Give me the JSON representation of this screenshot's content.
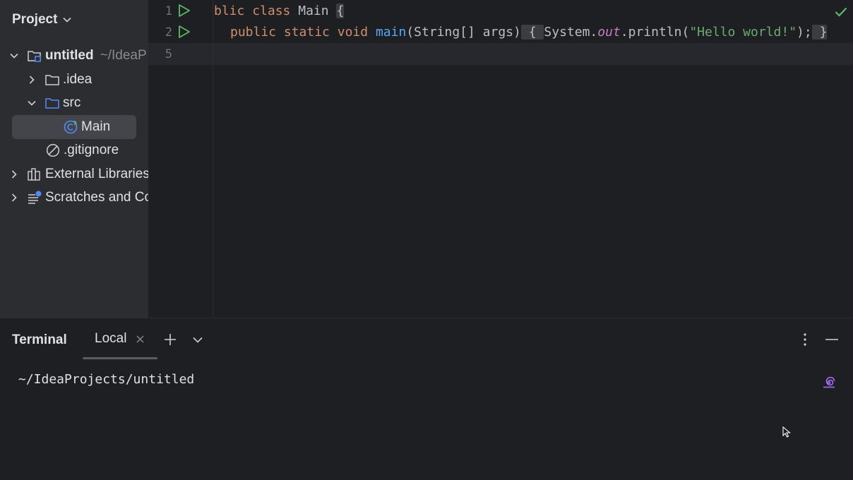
{
  "project_panel": {
    "title": "Project",
    "tree": [
      {
        "label": "untitled",
        "hint": "~/IdeaP",
        "icon": "module-folder-icon",
        "expanded": true
      },
      {
        "label": ".idea",
        "icon": "folder-icon",
        "expanded": false
      },
      {
        "label": "src",
        "icon": "source-folder-icon",
        "expanded": true
      },
      {
        "label": "Main",
        "icon": "java-class-icon",
        "selected": true
      },
      {
        "label": ".gitignore",
        "icon": "ignored-file-icon"
      },
      {
        "label": "External Libraries",
        "icon": "libraries-icon",
        "expanded": false
      },
      {
        "label": "Scratches and Co",
        "icon": "scratches-icon",
        "expanded": false
      }
    ]
  },
  "editor": {
    "line_numbers": [
      "1",
      "2",
      "5"
    ],
    "line1": {
      "kw1": "blic",
      "kw2": "class",
      "name": "Main",
      "brace": "{"
    },
    "line2": {
      "kw_public": "public",
      "kw_static": "static",
      "kw_void": "void",
      "method": "main",
      "params": "(String[] args)",
      "open_brace": "{",
      "sys": "System.",
      "out": "out",
      "println": ".println(",
      "string": "\"Hello world!\"",
      "close": ");",
      "close_brace": "}"
    },
    "status_icon": "check-icon"
  },
  "terminal": {
    "title": "Terminal",
    "tab_label": "Local",
    "path": "~/IdeaProjects/untitled"
  },
  "colors": {
    "background": "#1e1f22",
    "sidebar": "#2b2d30",
    "keyword": "#cf8e6d",
    "function": "#56a8f5",
    "string": "#6aab73",
    "field": "#c77dbb",
    "run_green": "#5fb865",
    "ai_purple": "#a36cf3"
  }
}
